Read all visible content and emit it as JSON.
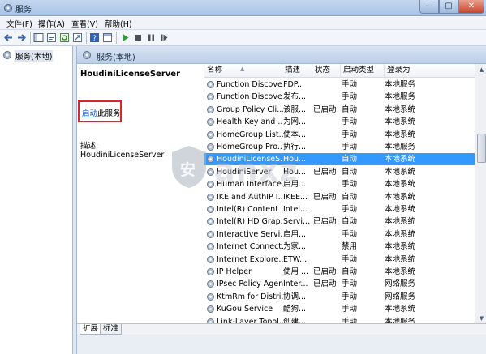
{
  "window": {
    "title": "服务",
    "buttons": {
      "minimize": "—",
      "maximize": "▢",
      "close": "✕"
    }
  },
  "menu": [
    "文件(F)",
    "操作(A)",
    "查看(V)",
    "帮助(H)"
  ],
  "toolbar_icons": [
    "back-arrow-icon",
    "forward-arrow-icon",
    "console-tree-icon",
    "properties-icon",
    "refresh-icon",
    "export-list-icon",
    "help-icon",
    "panel-icon",
    "play-icon",
    "stop-icon",
    "pause-icon",
    "restart-icon"
  ],
  "tree": {
    "root_label": "服务(本地)"
  },
  "pane": {
    "header": "服务(本地)",
    "selected_service": "HoudiniLicenseServer",
    "start_link": "启动",
    "start_rest": "此服务",
    "description_label": "描述:",
    "description_value": "HoudiniLicenseServer"
  },
  "list": {
    "columns": [
      "名称",
      "描述",
      "状态",
      "启动类型",
      "登录为"
    ],
    "rows": [
      [
        "Function Discove...",
        "FDP...",
        "",
        "手动",
        "本地服务"
      ],
      [
        "Function Discove...",
        "发布...",
        "",
        "手动",
        "本地服务"
      ],
      [
        "Group Policy Cli...",
        "该服...",
        "已启动",
        "自动",
        "本地系统"
      ],
      [
        "Health Key and ...",
        "为网...",
        "",
        "手动",
        "本地系统"
      ],
      [
        "HomeGroup List...",
        "使本...",
        "",
        "手动",
        "本地系统"
      ],
      [
        "HomeGroup Pro...",
        "执行...",
        "",
        "手动",
        "本地服务"
      ],
      [
        "HoudiniLicenseS...",
        "Hou...",
        "",
        "自动",
        "本地系统"
      ],
      [
        "HoudiniServer",
        "Hou...",
        "已启动",
        "自动",
        "本地系统"
      ],
      [
        "Human Interface...",
        "启用...",
        "",
        "手动",
        "本地系统"
      ],
      [
        "IKE and AuthIP I...",
        "IKEE...",
        "已启动",
        "自动",
        "本地系统"
      ],
      [
        "Intel(R) Content ...",
        "Intel...",
        "",
        "手动",
        "本地系统"
      ],
      [
        "Intel(R) HD Grap...",
        "Servi...",
        "已启动",
        "自动",
        "本地系统"
      ],
      [
        "Interactive Servi...",
        "启用...",
        "",
        "手动",
        "本地系统"
      ],
      [
        "Internet Connect...",
        "为家...",
        "",
        "禁用",
        "本地系统"
      ],
      [
        "Internet Explore...",
        "ETW...",
        "",
        "手动",
        "本地系统"
      ],
      [
        "IP Helper",
        "使用 ...",
        "已启动",
        "自动",
        "本地系统"
      ],
      [
        "IPsec Policy Agent",
        "Inter...",
        "已启动",
        "手动",
        "网络服务"
      ],
      [
        "KtmRm for Distri...",
        "协调...",
        "",
        "手动",
        "网络服务"
      ],
      [
        "KuGou Service",
        "酷狗...",
        "",
        "手动",
        "本地系统"
      ],
      [
        "Link-Layer Topol...",
        "创建...",
        "",
        "手动",
        "本地服务"
      ]
    ],
    "selected_index": 6
  },
  "tabs": [
    "扩展",
    "标准"
  ],
  "watermark": {
    "glyph": "安",
    "text": "anxz",
    "url": ".com"
  },
  "colors": {
    "selection": "#3399ff",
    "link": "#1750b8",
    "highlight_box": "#d8262c"
  }
}
